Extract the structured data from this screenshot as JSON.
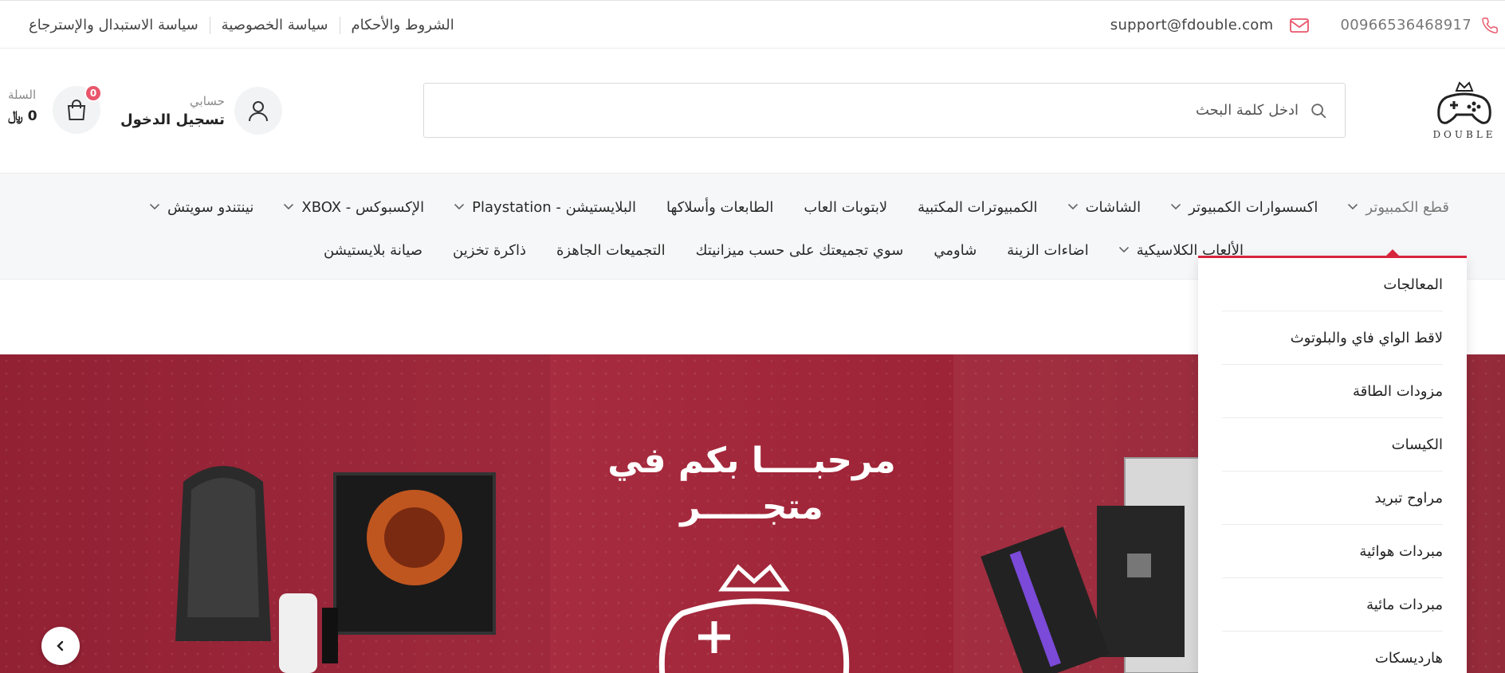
{
  "topbar": {
    "phone": "00966536468917",
    "email": "support@fdouble.com",
    "links": [
      "الشروط والأحكام",
      "سياسة الخصوصية",
      "سياسة الاستبدال والإسترجاع"
    ]
  },
  "logo": {
    "text": "DOUBLE"
  },
  "search": {
    "placeholder": "ادخل كلمة البحث",
    "value": ""
  },
  "account": {
    "label": "حسابي",
    "action": "تسجيل الدخول"
  },
  "cart": {
    "label": "السلة",
    "count": "0",
    "total": "0 ﷼"
  },
  "nav": {
    "row1": [
      {
        "label": "قطع الكمبيوتر",
        "dropdown": true
      },
      {
        "label": "اكسسوارات الكمبيوتر",
        "dropdown": true
      },
      {
        "label": "الشاشات",
        "dropdown": true
      },
      {
        "label": "الكمبيوترات المكتبية",
        "dropdown": false
      },
      {
        "label": "لابتوبات العاب",
        "dropdown": false
      },
      {
        "label": "الطابعات وأسلاكها",
        "dropdown": false
      },
      {
        "label": "البلايستيشن - Playstation",
        "dropdown": true
      },
      {
        "label": "الإكسبوكس - XBOX",
        "dropdown": true
      },
      {
        "label": "نينتندو سويتش",
        "dropdown": true
      }
    ],
    "row2": [
      {
        "label": "الألعاب الكلاسيكية",
        "dropdown": true
      },
      {
        "label": "اضاءات الزينة",
        "dropdown": false
      },
      {
        "label": "شاومي",
        "dropdown": false
      },
      {
        "label": "سوي تجميعتك على حسب ميزانيتك",
        "dropdown": false
      },
      {
        "label": "التجميعات الجاهزة",
        "dropdown": false
      },
      {
        "label": "ذاكرة تخزين",
        "dropdown": false
      },
      {
        "label": "صيانة بلايستيشن",
        "dropdown": false
      }
    ]
  },
  "dropdown": {
    "items": [
      "المعالجات",
      "لاقط الواي فاي والبلوتوث",
      "مزودات الطاقة",
      "الكيسات",
      "مراوح تبريد",
      "مبردات هوائية",
      "مبردات مائية",
      "هارديسكات"
    ]
  },
  "hero": {
    "title_line1": "مرحبــــا بكم في",
    "title_line2": "متجـــــر"
  },
  "colors": {
    "accent": "#d6253c",
    "hero_bg": "#a12a3c",
    "badge": "#e9566b"
  }
}
